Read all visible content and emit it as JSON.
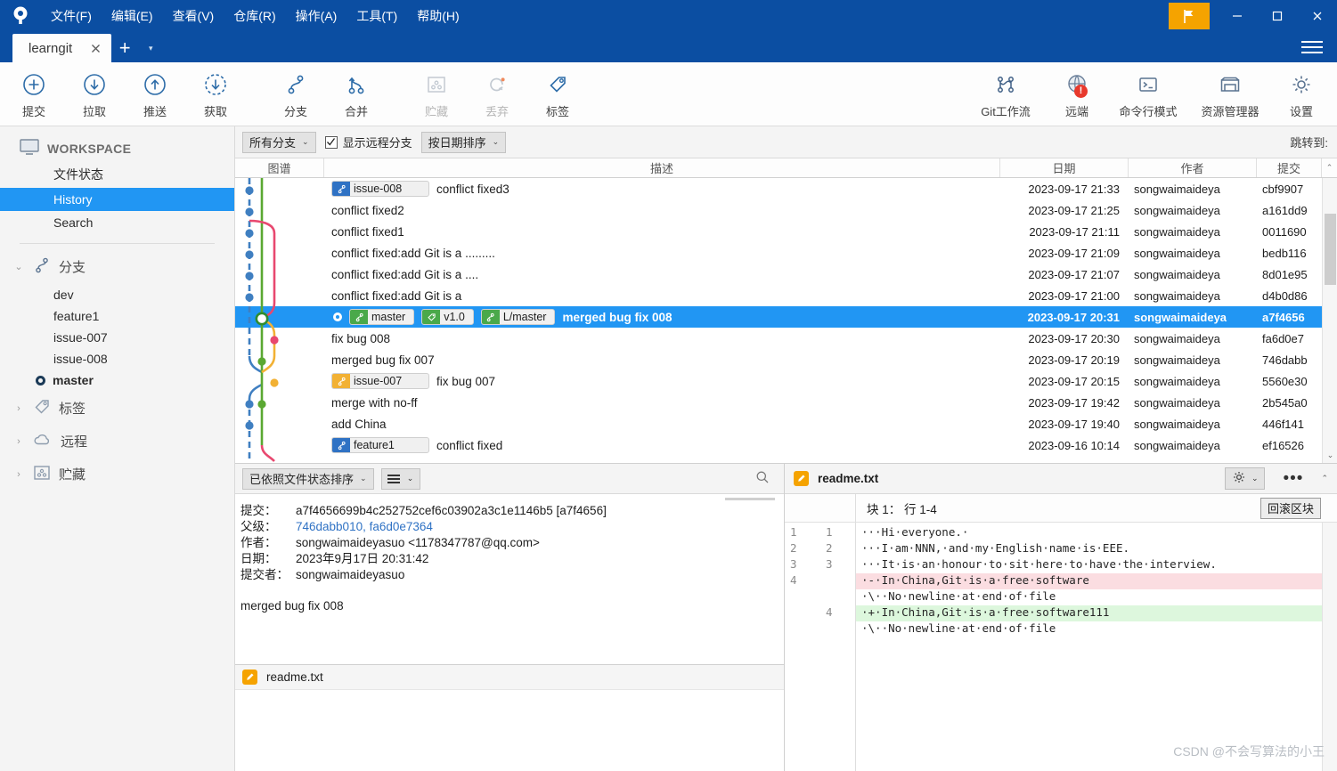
{
  "window": {
    "menu": [
      {
        "label": "文件(F)",
        "accel": "F"
      },
      {
        "label": "编辑(E)",
        "accel": "E"
      },
      {
        "label": "查看(V)",
        "accel": "V"
      },
      {
        "label": "仓库(R)",
        "accel": "R"
      },
      {
        "label": "操作(A)",
        "accel": "A"
      },
      {
        "label": "工具(T)",
        "accel": "T"
      },
      {
        "label": "帮助(H)",
        "accel": "H"
      }
    ],
    "controls": {
      "flag": "flag-icon",
      "minimize": "—",
      "maximize": "▢",
      "close": "✕",
      "menu": "hamburger-icon"
    }
  },
  "tabs": {
    "active": "learngit",
    "close": "✕",
    "add": "+",
    "caret": "▾"
  },
  "toolbar": {
    "left": [
      {
        "label": "提交",
        "icon": "commit-icon",
        "disabled": false
      },
      {
        "label": "拉取",
        "icon": "pull-icon",
        "disabled": false
      },
      {
        "label": "推送",
        "icon": "push-icon",
        "disabled": false
      },
      {
        "label": "获取",
        "icon": "fetch-icon",
        "disabled": false
      },
      {
        "label": "分支",
        "icon": "branch-icon",
        "disabled": false
      },
      {
        "label": "合并",
        "icon": "merge-icon",
        "disabled": false
      },
      {
        "label": "贮藏",
        "icon": "stash-icon",
        "disabled": true
      },
      {
        "label": "丢弃",
        "icon": "discard-icon",
        "disabled": true
      },
      {
        "label": "标签",
        "icon": "tag-icon",
        "disabled": false
      }
    ],
    "right": [
      {
        "label": "Git工作流",
        "icon": "gitflow-icon",
        "badge": ""
      },
      {
        "label": "远端",
        "icon": "remote-icon",
        "badge": "!"
      },
      {
        "label": "命令行模式",
        "icon": "terminal-icon",
        "badge": ""
      },
      {
        "label": "资源管理器",
        "icon": "explorer-icon",
        "badge": ""
      },
      {
        "label": "设置",
        "icon": "gear-icon",
        "badge": ""
      }
    ]
  },
  "sidebar": {
    "workspace": {
      "label": "WORKSPACE",
      "icon": "monitor-icon"
    },
    "workspace_items": [
      {
        "label": "文件状态",
        "selected": false
      },
      {
        "label": "History",
        "selected": true
      },
      {
        "label": "Search",
        "selected": false
      }
    ],
    "groups": [
      {
        "label": "分支",
        "icon": "branch-icon",
        "expanded": true,
        "chevron": "⌄"
      },
      {
        "label": "标签",
        "icon": "tag-icon",
        "expanded": false,
        "chevron": "›"
      },
      {
        "label": "远程",
        "icon": "cloud-icon",
        "expanded": false,
        "chevron": "›"
      },
      {
        "label": "贮藏",
        "icon": "stash-icon",
        "expanded": false,
        "chevron": "›"
      }
    ],
    "branches": [
      {
        "name": "dev",
        "current": false
      },
      {
        "name": "feature1",
        "current": false
      },
      {
        "name": "issue-007",
        "current": false
      },
      {
        "name": "issue-008",
        "current": false
      },
      {
        "name": "master",
        "current": true
      }
    ]
  },
  "filterbar": {
    "branch_filter": "所有分支",
    "show_remote_label": "显示远程分支",
    "show_remote_checked": true,
    "sort_mode": "按日期排序",
    "jump_to": "跳转到:",
    "caret": "⌄",
    "check": "✓"
  },
  "commit_table": {
    "columns": {
      "graph": "图谱",
      "description": "描述",
      "date": "日期",
      "author": "作者",
      "commit": "提交"
    },
    "rows": [
      {
        "msg": "conflict fixed3",
        "date": "2023-09-17 21:33",
        "author": "songwaimaideya",
        "hash": "cbf9907",
        "refs": [
          {
            "text": "issue-008",
            "kind": "blue",
            "icon": "branch-icon"
          }
        ],
        "selected": false,
        "current": false
      },
      {
        "msg": "conflict fixed2",
        "date": "2023-09-17 21:25",
        "author": "songwaimaideya",
        "hash": "a161dd9",
        "refs": [],
        "selected": false,
        "current": false
      },
      {
        "msg": "conflict fixed1",
        "date": "2023-09-17 21:11",
        "author": "songwaimaideya",
        "hash": "0011690",
        "refs": [],
        "selected": false,
        "current": false
      },
      {
        "msg": "conflict fixed:add Git is a .........",
        "date": "2023-09-17 21:09",
        "author": "songwaimaideya",
        "hash": "bedb116",
        "refs": [],
        "selected": false,
        "current": false
      },
      {
        "msg": "conflict fixed:add Git is a ....",
        "date": "2023-09-17 21:07",
        "author": "songwaimaideya",
        "hash": "8d01e95",
        "refs": [],
        "selected": false,
        "current": false
      },
      {
        "msg": "conflict fixed:add Git is a",
        "date": "2023-09-17 21:00",
        "author": "songwaimaideya",
        "hash": "d4b0d86",
        "refs": [],
        "selected": false,
        "current": false
      },
      {
        "msg": "merged bug fix 008",
        "date": "2023-09-17 20:31",
        "author": "songwaimaideya",
        "hash": "a7f4656",
        "refs": [
          {
            "text": "master",
            "kind": "green",
            "icon": "branch-icon"
          },
          {
            "text": "v1.0",
            "kind": "green",
            "icon": "tag-icon"
          },
          {
            "text": "L/master",
            "kind": "green",
            "icon": "branch-icon"
          }
        ],
        "selected": true,
        "current": true
      },
      {
        "msg": "fix bug 008",
        "date": "2023-09-17 20:30",
        "author": "songwaimaideya",
        "hash": "fa6d0e7",
        "refs": [],
        "selected": false,
        "current": false
      },
      {
        "msg": "merged bug fix 007",
        "date": "2023-09-17 20:19",
        "author": "songwaimaideya",
        "hash": "746dabb",
        "refs": [],
        "selected": false,
        "current": false
      },
      {
        "msg": "fix bug 007",
        "date": "2023-09-17 20:15",
        "author": "songwaimaideya",
        "hash": "5560e30",
        "refs": [
          {
            "text": "issue-007",
            "kind": "amber",
            "icon": "branch-icon"
          }
        ],
        "selected": false,
        "current": false
      },
      {
        "msg": "merge with no-ff",
        "date": "2023-09-17 19:42",
        "author": "songwaimaideya",
        "hash": "2b545a0",
        "refs": [],
        "selected": false,
        "current": false
      },
      {
        "msg": "add China",
        "date": "2023-09-17 19:40",
        "author": "songwaimaideya",
        "hash": "446f141",
        "refs": [],
        "selected": false,
        "current": false
      },
      {
        "msg": "conflict fixed",
        "date": "2023-09-16 10:14",
        "author": "songwaimaideya",
        "hash": "ef16526",
        "refs": [
          {
            "text": "feature1",
            "kind": "blue",
            "icon": "branch-icon"
          }
        ],
        "selected": false,
        "current": false
      }
    ]
  },
  "detail_panel": {
    "sort_label": "已依照文件状态排序",
    "view_icon": "list-view-icon",
    "search_icon": "search-icon",
    "caret": "⌄",
    "fields": [
      {
        "key": "提交：",
        "value": "a7f4656699b4c252752cef6c03902a3c1e1146b5 [a7f4656]",
        "link": false
      },
      {
        "key": "父级：",
        "value": "746dabb010, fa6d0e7364",
        "link": true
      },
      {
        "key": "作者：",
        "value": "songwaimaideyasuo <1178347787@qq.com>",
        "link": false
      },
      {
        "key": "日期：",
        "value": "2023年9月17日 20:31:42",
        "link": false
      },
      {
        "key": "提交者：",
        "value": "songwaimaideyasuo",
        "link": false
      }
    ],
    "message": "merged bug fix 008",
    "files": [
      {
        "name": "readme.txt",
        "icon": "modified-file-icon"
      }
    ]
  },
  "diff_panel": {
    "filename": "readme.txt",
    "file_icon": "modified-file-icon",
    "gear_icon": "gear-icon",
    "more_icon": "more-icon",
    "caret": "⌄",
    "hunk_label": "块 1： 行 1-4",
    "rollback_label": "回滚区块",
    "lines": [
      {
        "old": "1",
        "new": "1",
        "text": "···Hi·everyone.·",
        "kind": "ctx"
      },
      {
        "old": "2",
        "new": "2",
        "text": "···I·am·NNN,·and·my·English·name·is·EEE.",
        "kind": "ctx"
      },
      {
        "old": "3",
        "new": "3",
        "text": "···It·is·an·honour·to·sit·here·to·have·the·interview.",
        "kind": "ctx"
      },
      {
        "old": "4",
        "new": "",
        "text": "·-·In·China,Git·is·a·free·software",
        "kind": "del"
      },
      {
        "old": "",
        "new": "",
        "text": "·\\··No·newline·at·end·of·file",
        "kind": "ctx"
      },
      {
        "old": "",
        "new": "4",
        "text": "·+·In·China,Git·is·a·free·software111",
        "kind": "add"
      },
      {
        "old": "",
        "new": "",
        "text": "·\\··No·newline·at·end·of·file",
        "kind": "ctx"
      }
    ]
  },
  "watermark": "CSDN @不会写算法的小王",
  "colors": {
    "title_blue": "#0b4ea2",
    "selection_blue": "#2196f3",
    "accent_orange": "#f5a300",
    "graph_blue": "#3f7fc1",
    "graph_green": "#5aa832",
    "graph_pink": "#e8486f",
    "graph_amber": "#f2b134",
    "diff_add": "#ddf7dd",
    "diff_del": "#fbdde1"
  }
}
